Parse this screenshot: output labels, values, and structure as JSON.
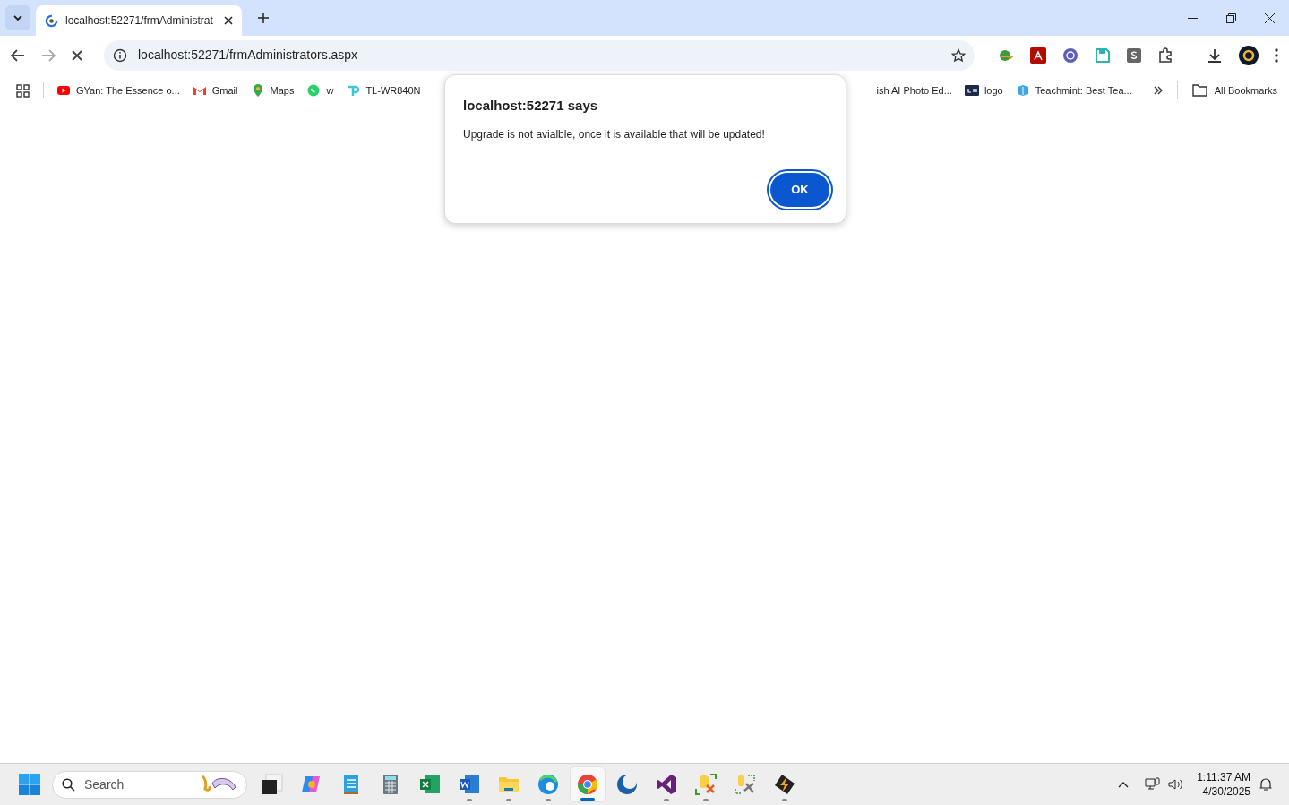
{
  "tab": {
    "title": "localhost:52271/frmAdministrat",
    "selected": true
  },
  "address_bar": {
    "url": "localhost:52271/frmAdministrators.aspx"
  },
  "bookmarks_left": [
    {
      "kind": "youtube",
      "label": "GYan: The Essence o..."
    },
    {
      "kind": "gmail",
      "label": "Gmail"
    },
    {
      "kind": "maps",
      "label": "Maps"
    },
    {
      "kind": "whatsapp",
      "label": "w"
    },
    {
      "kind": "tplink",
      "label": "TL-WR840N"
    }
  ],
  "bookmarks_right": [
    {
      "kind": "none",
      "label": "ish AI Photo Ed..."
    },
    {
      "kind": "gh",
      "label": "logo"
    },
    {
      "kind": "teachmint",
      "label": "Teachmint: Best Tea..."
    }
  ],
  "all_bookmarks": "All Bookmarks",
  "dialog": {
    "title": "localhost:52271 says",
    "message": "Upgrade is not avialble, once it is available that will be updated!",
    "button": "OK"
  },
  "taskbar": {
    "search_placeholder": "Search",
    "apps": [
      {
        "kind": "taskview",
        "running": false,
        "active": false
      },
      {
        "kind": "copilot",
        "running": false,
        "active": false
      },
      {
        "kind": "notepad",
        "running": false,
        "active": false
      },
      {
        "kind": "calculator",
        "running": false,
        "active": false
      },
      {
        "kind": "excel",
        "running": false,
        "active": false
      },
      {
        "kind": "word",
        "running": true,
        "active": false
      },
      {
        "kind": "explorer",
        "running": true,
        "active": false
      },
      {
        "kind": "edge",
        "running": true,
        "active": false
      },
      {
        "kind": "chrome",
        "running": true,
        "active": true
      },
      {
        "kind": "moon",
        "running": false,
        "active": false
      },
      {
        "kind": "visualstudio",
        "running": true,
        "active": false
      },
      {
        "kind": "dbtool",
        "running": true,
        "active": false
      },
      {
        "kind": "dbtools",
        "running": false,
        "active": false
      },
      {
        "kind": "winamp",
        "running": true,
        "active": false
      }
    ],
    "time": "1:11:37 AM",
    "date": "4/30/2025"
  }
}
